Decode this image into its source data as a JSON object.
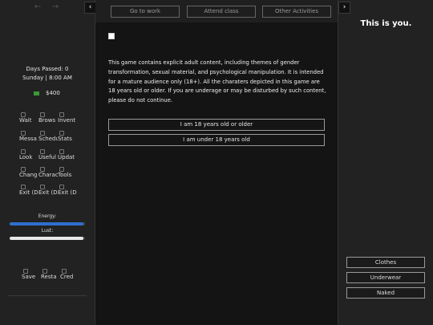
{
  "left": {
    "nav_back": "←",
    "nav_forward": "→",
    "collapse": "‹",
    "days_passed": "Days Passed: 0",
    "date_time": "Sunday | 8:00 AM",
    "money": "$400",
    "grid": [
      [
        "Wait",
        "Brows",
        "Invent"
      ],
      [
        "Messa",
        "Schedu",
        "Stats"
      ],
      [
        "Look",
        "Useful",
        "Updat"
      ],
      [
        "Chang",
        "Charac",
        "Tools"
      ],
      [
        "Exit (Disab",
        "Exit (Disab",
        "Exit (Disab"
      ]
    ],
    "energy_label": "Energy:",
    "energy_fraction": 0.98,
    "lust_label": "Lust:",
    "lust_fraction": 0.98,
    "bottom": [
      "Save",
      "Resta",
      "Cred"
    ]
  },
  "topbar": {
    "buttons": [
      "Go to work",
      "Attend class",
      "Other Activities"
    ]
  },
  "main": {
    "disclaimer": "This game contains explicit adult content, including themes of gender transformation, sexual material, and psychological manipulation. It is intended for a mature audience only (18+). All the charaters depicted in this game are 18 years old or older. If you are underage or may be disturbed by such content, please do not continue.",
    "choices": [
      "I am 18 years old or older",
      "I am under 18 years old"
    ]
  },
  "right": {
    "collapse": "›",
    "title": "This is you.",
    "outfits": [
      "Clothes",
      "Underwear",
      "Naked"
    ]
  },
  "colors": {
    "energy": "#2f6fd0",
    "lust": "#e8e8e8"
  }
}
